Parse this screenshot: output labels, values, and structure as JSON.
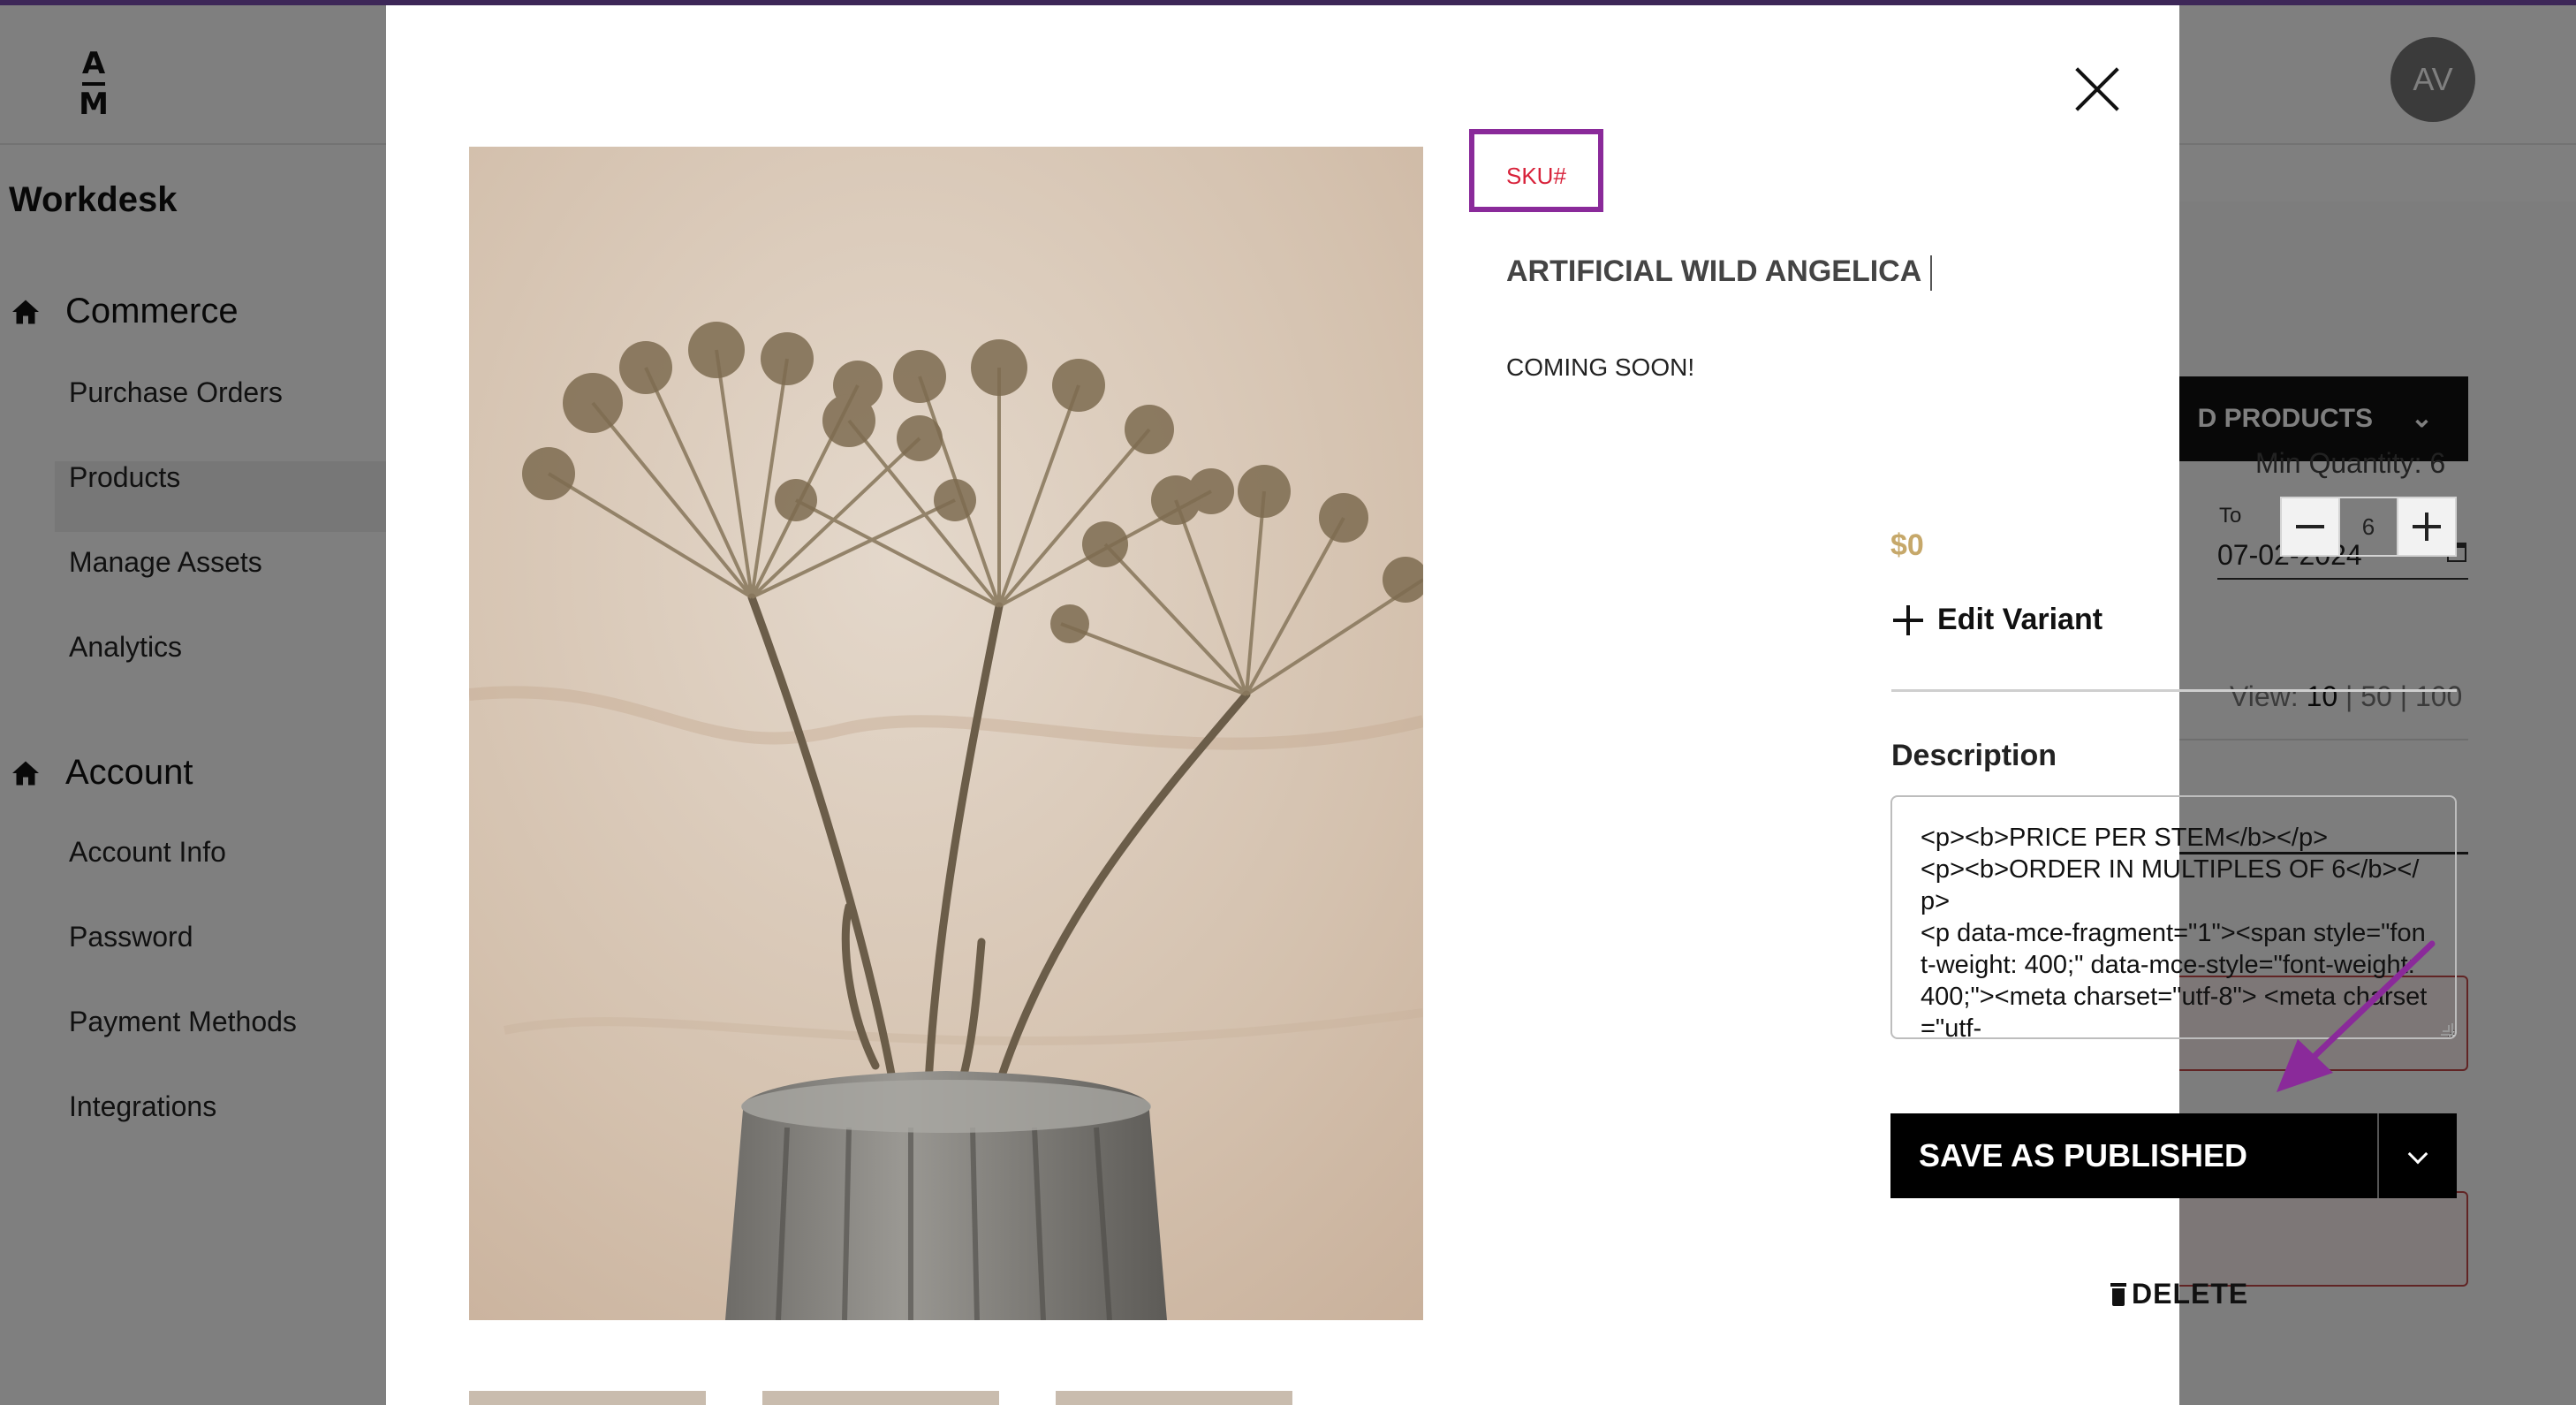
{
  "app": {
    "logo_top": "A",
    "logo_bottom": "M",
    "avatar_initials": "AV"
  },
  "sidebar": {
    "title": "Workdesk",
    "sections": [
      {
        "label": "Commerce",
        "items": [
          "Purchase Orders",
          "Products",
          "Manage Assets",
          "Analytics"
        ]
      },
      {
        "label": "Account",
        "items": [
          "Account Info",
          "Password",
          "Payment Methods",
          "Integrations"
        ]
      }
    ],
    "active_item": "Products"
  },
  "background": {
    "add_products_label": "D PRODUCTS",
    "to_label": "To",
    "to_date": "07-02-2024",
    "view_label": "View:",
    "view_options": [
      "10",
      "50",
      "100"
    ],
    "view_selected": "10"
  },
  "modal": {
    "sku_label": "SKU#",
    "product_title": "ARTIFICIAL WILD ANGELICA",
    "status": "COMING SOON!",
    "min_quantity_label": "Min Quantity:",
    "min_quantity_value": "6",
    "quantity": "6",
    "price": "$0",
    "edit_variant_label": "Edit Variant",
    "description_label": "Description",
    "description_text": "<p><b>PRICE PER STEM</b></p>\n<p><b>ORDER IN MULTIPLES OF 6</b></p>\n<p data-mce-fragment=\"1\"><span style=\"font-weight: 400;\" data-mce-style=\"font-weight: 400;\"><meta charset=\"utf-8\"> <meta charset=\"utf-",
    "save_label": "SAVE AS PUBLISHED",
    "delete_label": "DELETE"
  },
  "colors": {
    "sku_highlight": "#8a2a9a",
    "sku_text": "#d8223a",
    "price": "#c6a86a",
    "annotation_arrow": "#8a2a9a",
    "topline": "#7a4fb0"
  },
  "icons": {
    "close": "close-icon",
    "home": "home-icon",
    "plus": "plus-icon",
    "minus": "minus-icon",
    "trash": "trash-icon",
    "chevron": "chevron-down-icon",
    "calendar": "calendar-icon"
  }
}
